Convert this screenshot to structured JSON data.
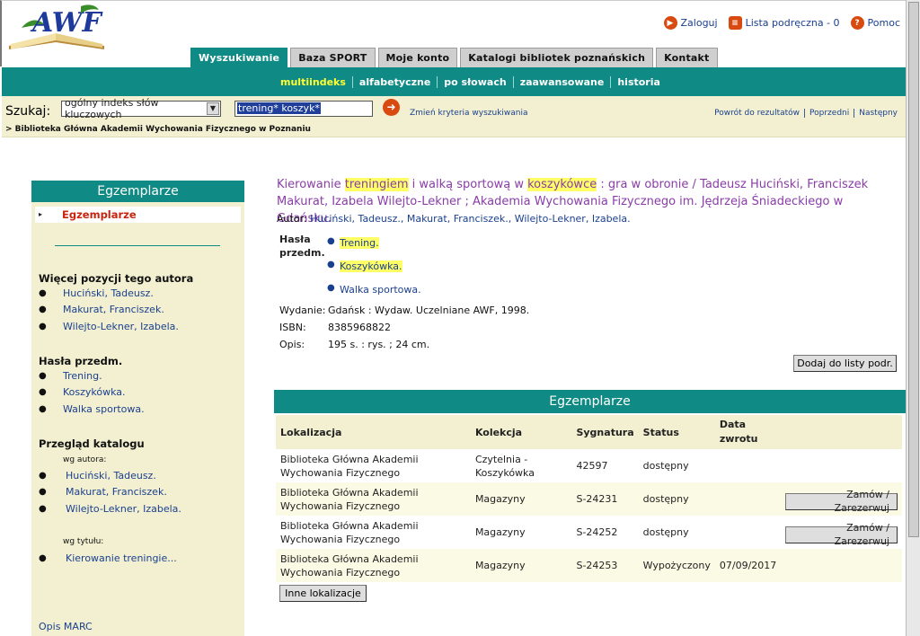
{
  "header": {
    "logo_text": "AWF",
    "links": [
      {
        "label": "Zaloguj",
        "icon": "arrow-right-icon",
        "color": "#d84a10"
      },
      {
        "label": "Lista podręczna - 0",
        "icon": "list-icon",
        "color": "#d84a10"
      },
      {
        "label": "Pomoc",
        "icon": "help-icon",
        "color": "#d84a10"
      }
    ]
  },
  "tabs": [
    {
      "label": "Wyszukiwanie",
      "active": true
    },
    {
      "label": "Baza SPORT"
    },
    {
      "label": "Moje konto"
    },
    {
      "label": "Katalogi bibliotek poznańskich"
    },
    {
      "label": "Kontakt"
    }
  ],
  "subnav": [
    "multiindeks",
    "alfabetyczne",
    "po słowach",
    "zaawansowane",
    "historia"
  ],
  "search": {
    "label": "Szukaj:",
    "index_selected": "ogólny indeks słów kluczowych",
    "query": "trening* koszyk*",
    "change_criteria": "Zmień kryteria wyszukiwania",
    "back": "Powrót do rezultatów",
    "prev": "Poprzedni",
    "next": "Następny",
    "breadcrumb": "> Biblioteka Główna Akademii Wychowania Fizycznego w Poznaniu"
  },
  "left": {
    "heading": "Egzemplarze",
    "active_item": "Egzemplarze",
    "more_by_author_title": "Więcej pozycji tego autora",
    "authors": [
      "Huciński, Tadeusz.",
      "Makurat, Franciszek.",
      "Wilejto-Lekner, Izabela."
    ],
    "subjects_title": "Hasła przedm.",
    "subjects": [
      "Trening.",
      "Koszykówka.",
      "Walka sportowa."
    ],
    "browse_title": "Przegląd katalogu",
    "by_author_label": "wg autora:",
    "browse_authors": [
      "Huciński, Tadeusz.",
      "Makurat, Franciszek.",
      "Wilejto-Lekner, Izabela."
    ],
    "by_title_label": "wg tytułu:",
    "browse_title_item": "Kierowanie treningie...",
    "marc": "Opis MARC"
  },
  "record": {
    "title_parts": [
      "Kierowanie ",
      "treningiem",
      " i walką sportową w ",
      "koszykówce",
      " : gra w obronie / Tadeusz Huciński, Franciszek Makurat, Izabela Wilejto-Lekner ; Akademia Wychowania Fizycznego im. Jędrzeja Śniadeckiego w Gdańsku."
    ],
    "author_label": "Autor:",
    "author_value": "Huciński, Tadeusz., Makurat, Franciszek., Wilejto-Lekner, Izabela.",
    "subjects_label": "Hasła przedm.",
    "subjects": [
      "Trening.",
      "Koszykówka.",
      "Walka sportowa."
    ],
    "edition_label": "Wydanie:",
    "edition_value": "Gdańsk : Wydaw. Uczelniane AWF, 1998.",
    "isbn_label": "ISBN:",
    "isbn_value": "8385968822",
    "desc_label": "Opis:",
    "desc_value": "195 s. : rys. ; 24 cm.",
    "add_button": "Dodaj do listy podr."
  },
  "copies": {
    "heading": "Egzemplarze",
    "columns": [
      "Lokalizacja",
      "Kolekcja",
      "Sygnatura",
      "Status",
      "Data zwrotu"
    ],
    "rows": [
      {
        "loc": "Biblioteka Główna Akademii Wychowania Fizycznego",
        "coll": "Czytelnia - Koszykówka",
        "sig": "42597",
        "status": "dostępny",
        "date": "",
        "action": ""
      },
      {
        "loc": "Biblioteka Główna Akademii Wychowania Fizycznego",
        "coll": "Magazyny",
        "sig": "S-24231",
        "status": "dostępny",
        "date": "",
        "action": "Zamów / Zarezerwuj"
      },
      {
        "loc": "Biblioteka Główna Akademii Wychowania Fizycznego",
        "coll": "Magazyny",
        "sig": "S-24252",
        "status": "dostępny",
        "date": "",
        "action": "Zamów / Zarezerwuj"
      },
      {
        "loc": "Biblioteka Główna Akademii Wychowania Fizycznego",
        "coll": "Magazyny",
        "sig": "S-24253",
        "status": "Wypożyczony",
        "date": "07/09/2017",
        "action": ""
      }
    ],
    "other_locations": "Inne lokalizacje"
  }
}
